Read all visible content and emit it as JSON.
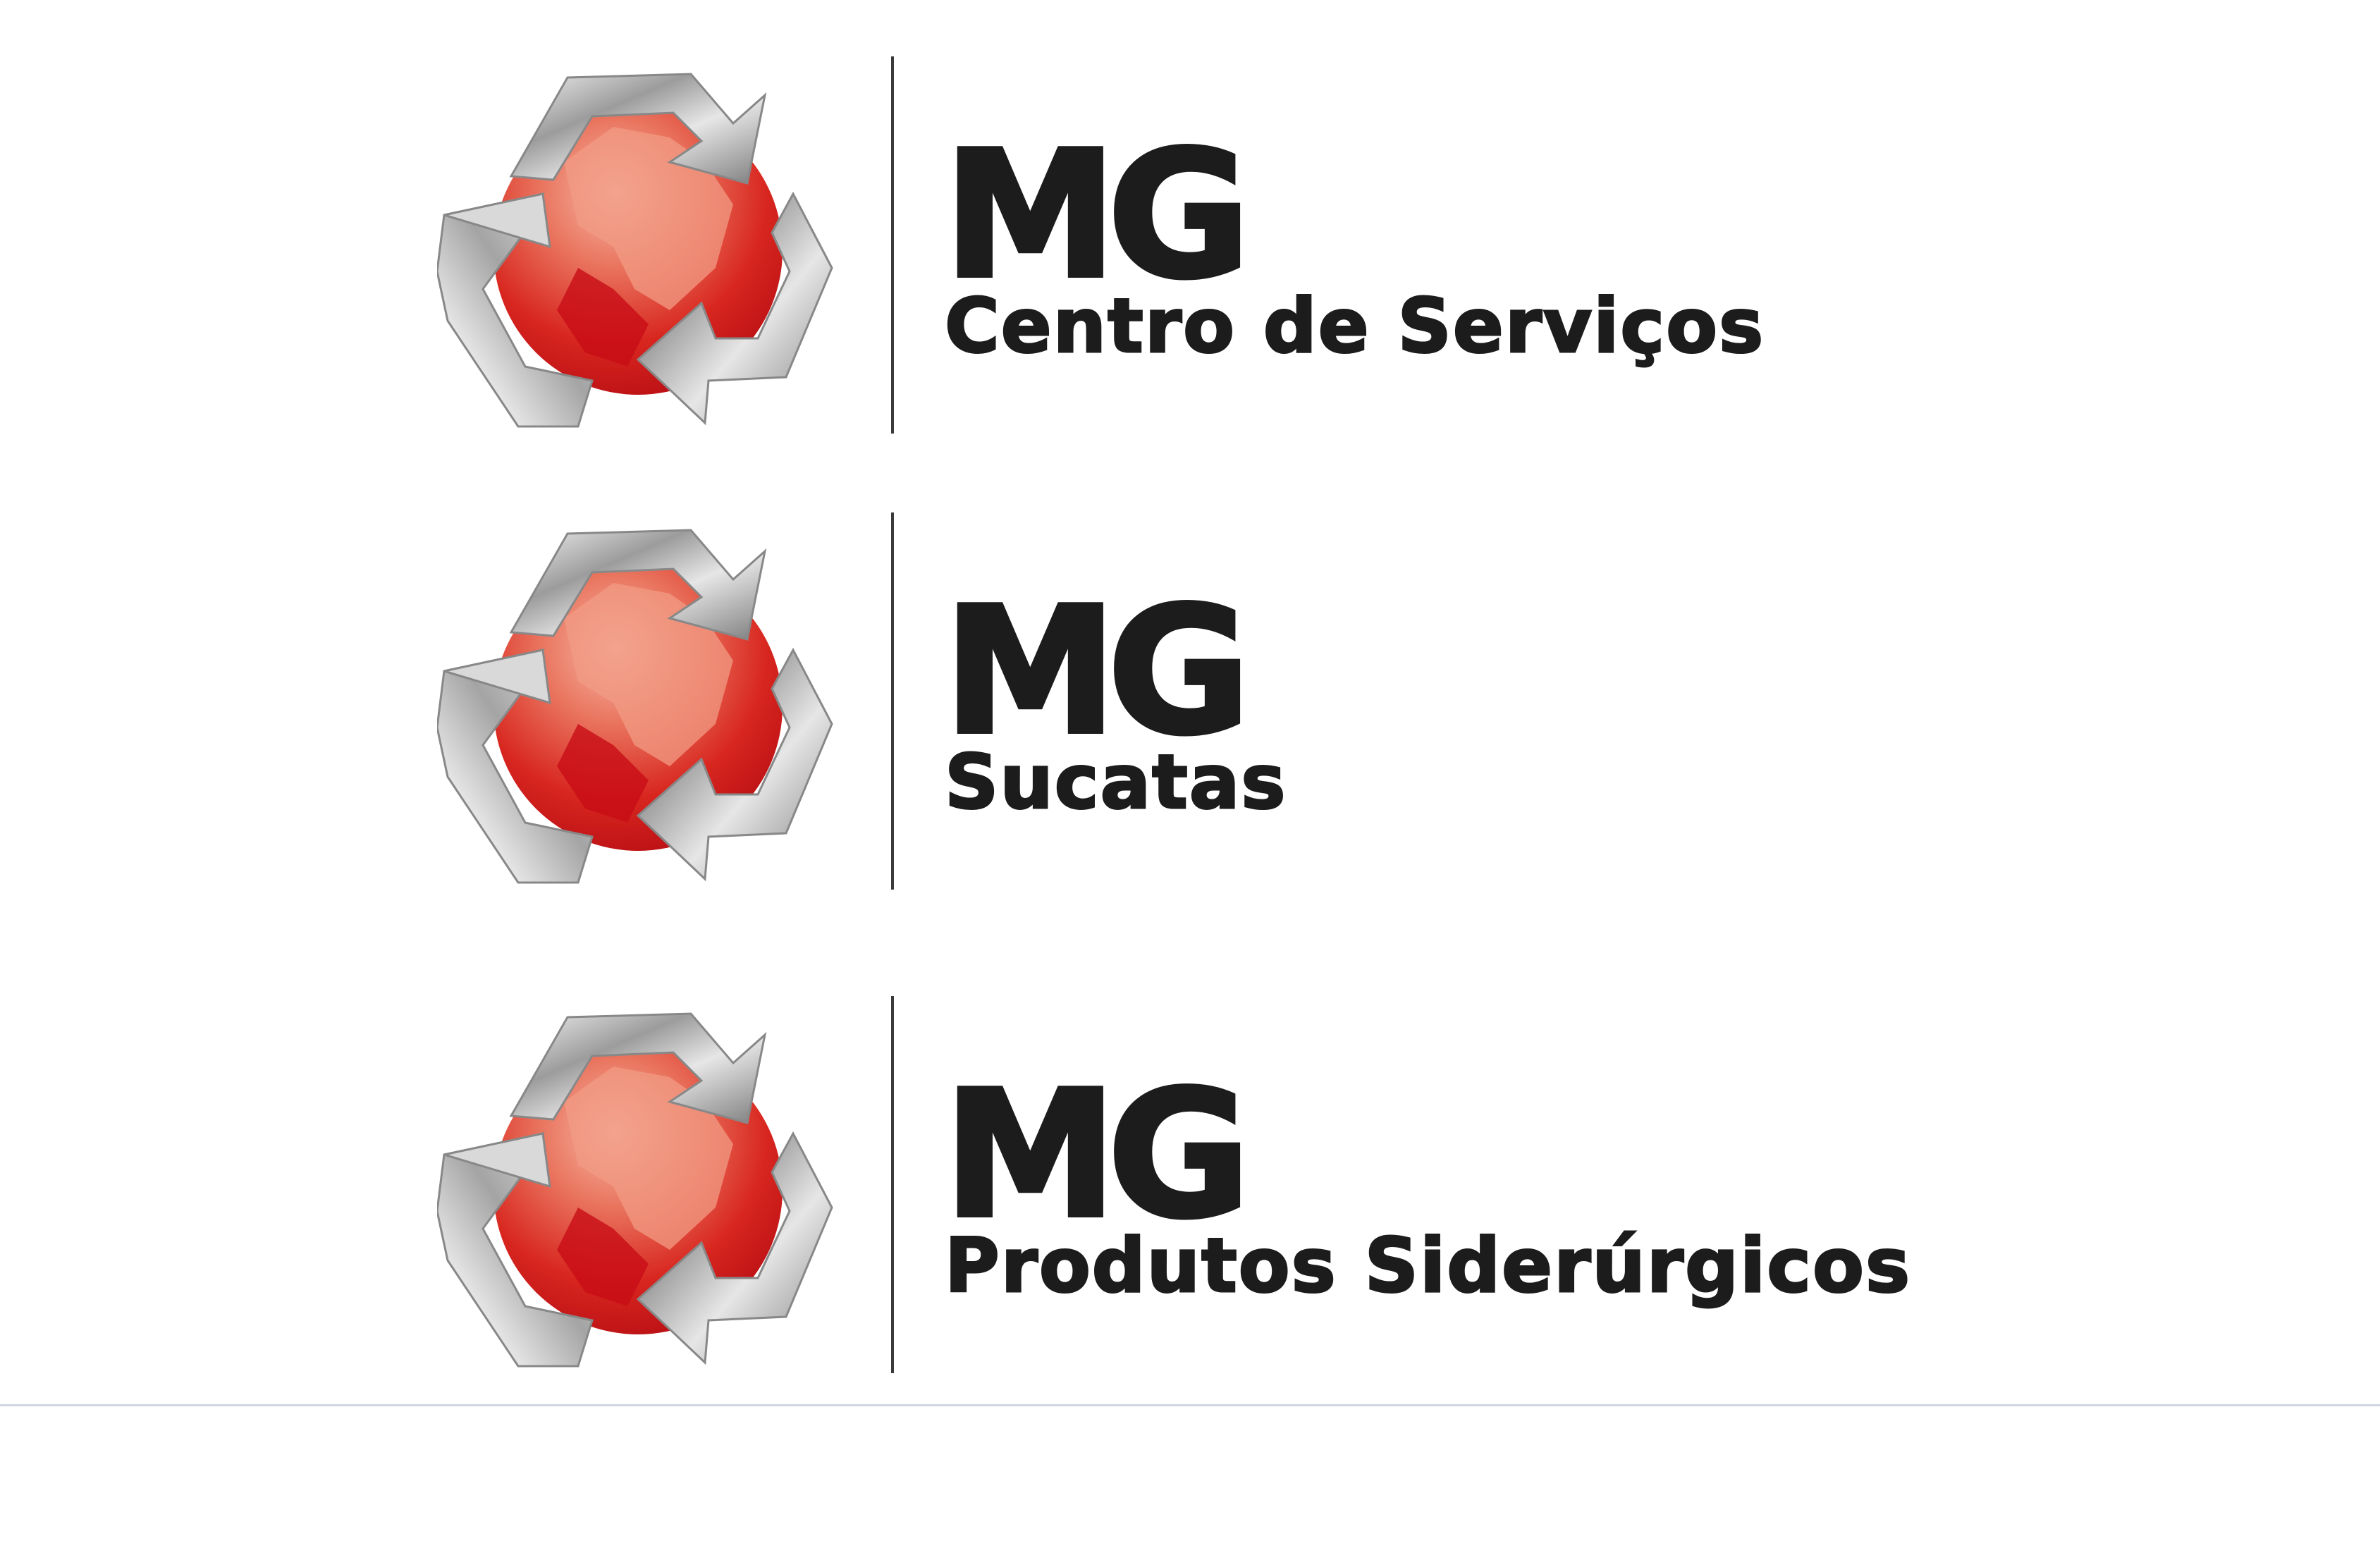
{
  "brands": [
    {
      "title": "MG",
      "subtitle": "Centro de Serviços"
    },
    {
      "title": "MG",
      "subtitle": "Sucatas"
    },
    {
      "title": "MG",
      "subtitle": "Produtos Siderúrgicos"
    }
  ],
  "colors": {
    "globe_red": "#d0131c",
    "globe_light": "#ef9a80",
    "arrow_silver": "#c4c4c4",
    "text": "#1c1c1c",
    "divider": "#3a3a3a"
  },
  "icons": [
    "recycle-globe-logo"
  ]
}
